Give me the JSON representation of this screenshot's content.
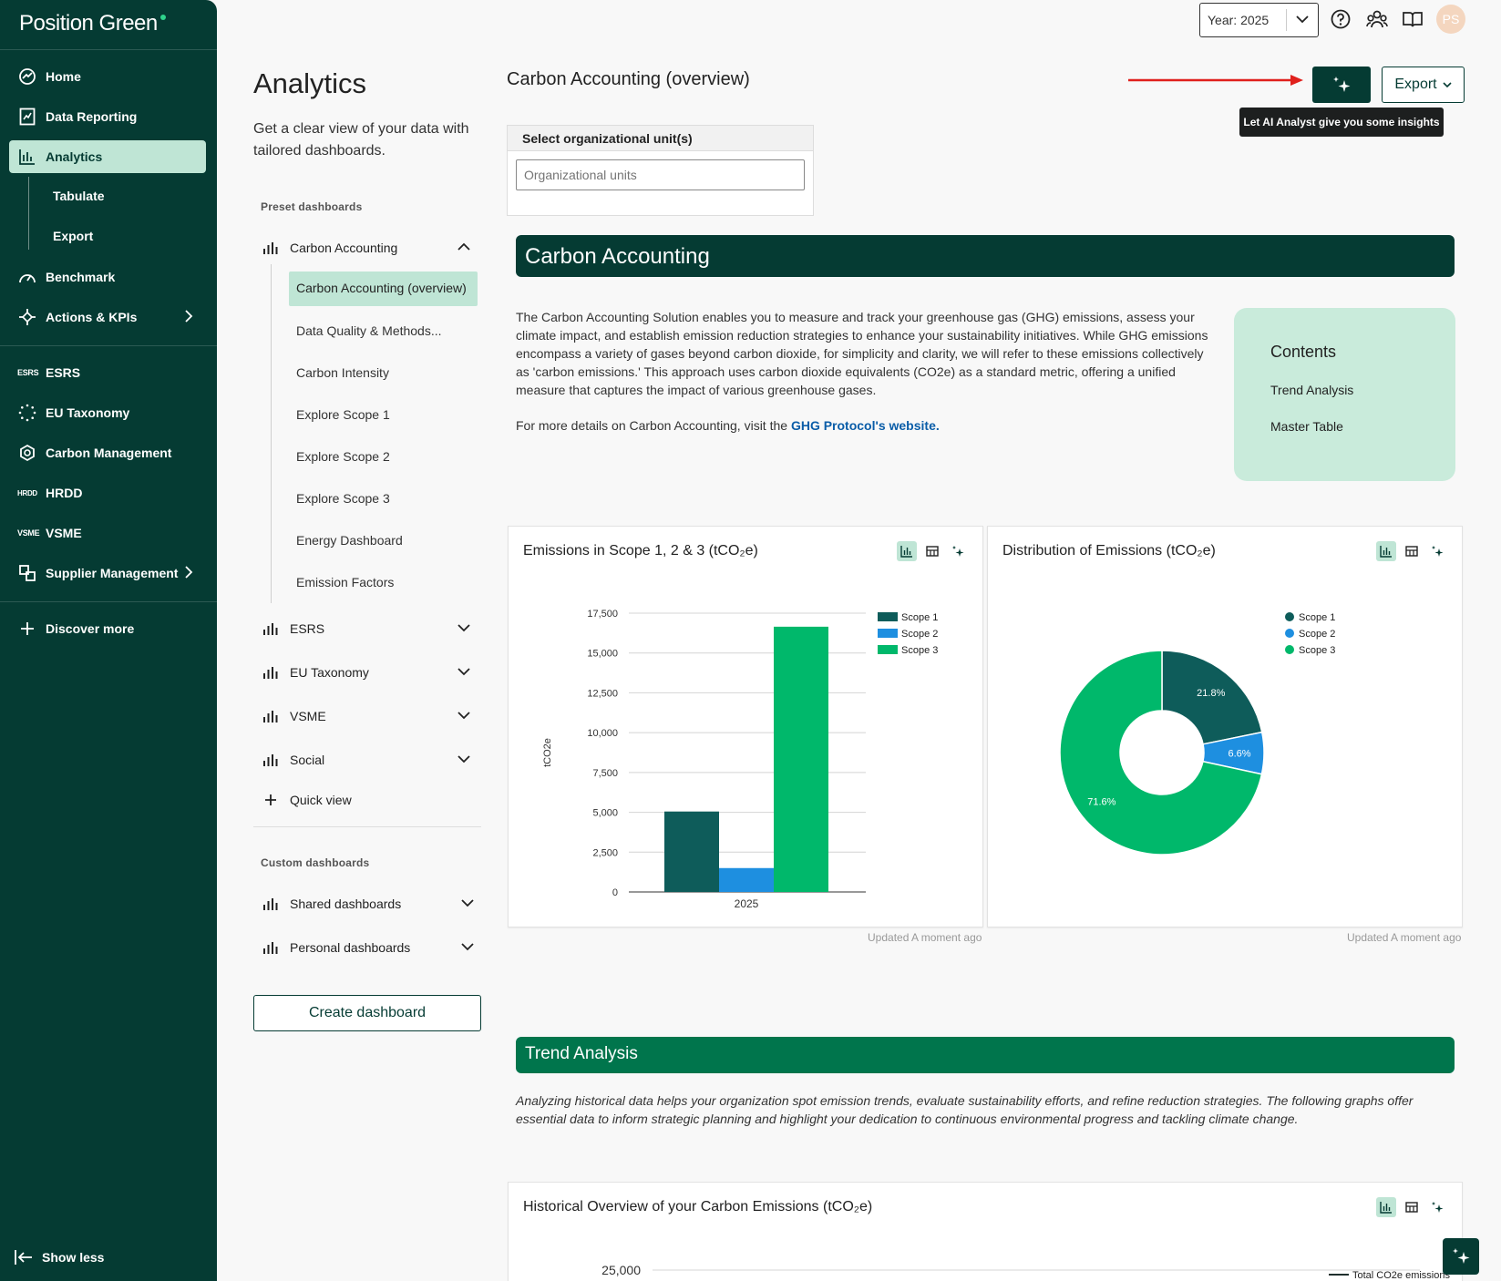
{
  "app": {
    "logo": "Position Green"
  },
  "sidebar": {
    "items": [
      {
        "label": "Home"
      },
      {
        "label": "Data Reporting"
      },
      {
        "label": "Analytics"
      },
      {
        "label": "Benchmark"
      },
      {
        "label": "Actions & KPIs"
      },
      {
        "label": "ESRS",
        "badge": "ESRS"
      },
      {
        "label": "EU Taxonomy"
      },
      {
        "label": "Carbon Management"
      },
      {
        "label": "HRDD",
        "badge": "HRDD"
      },
      {
        "label": "VSME",
        "badge": "VSME"
      },
      {
        "label": "Supplier Management"
      }
    ],
    "sub_items": [
      "Tabulate",
      "Export"
    ],
    "discover": "Discover more",
    "show_less": "Show less"
  },
  "panel": {
    "title": "Analytics",
    "description": "Get a clear view of your data with tailored dashboards.",
    "preset_label": "Preset dashboards",
    "custom_label": "Custom dashboards",
    "groups": [
      "Carbon Accounting",
      "ESRS",
      "EU Taxonomy",
      "VSME",
      "Social"
    ],
    "carbon_items": [
      "Carbon Accounting (overview)",
      "Data Quality & Methods...",
      "Carbon Intensity",
      "Explore Scope 1",
      "Explore Scope 2",
      "Explore Scope 3",
      "Energy Dashboard",
      "Emission Factors"
    ],
    "quick_view": "Quick view",
    "custom_groups": [
      "Shared dashboards",
      "Personal dashboards"
    ],
    "create_button": "Create dashboard"
  },
  "topbar": {
    "year": "Year: 2025",
    "avatar": "PS"
  },
  "header": {
    "title": "Carbon Accounting (overview)",
    "export": "Export",
    "tooltip": "Let AI Analyst give you some insights"
  },
  "org_select": {
    "label": "Select organizational unit(s)",
    "placeholder": "Organizational units"
  },
  "ca_section": {
    "banner": "Carbon Accounting",
    "text": "The Carbon Accounting Solution enables you to measure and track your greenhouse gas (GHG) emissions, assess your climate impact, and establish emission reduction strategies to enhance your sustainability initiatives. While GHG emissions encompass a variety of gases beyond carbon dioxide, for simplicity and clarity, we will refer to these emissions collectively as 'carbon emissions.' This approach uses carbon dioxide equivalents (CO2e) as a standard metric, offering a unified measure that captures the impact of various greenhouse gases.",
    "link_prefix": "For more details on Carbon Accounting, visit the ",
    "link_text": "GHG Protocol's website.",
    "contents_title": "Contents",
    "contents": [
      "Trend Analysis",
      "Master Table"
    ]
  },
  "cards": {
    "bar_title": "Emissions in Scope 1, 2 & 3 (tCO₂e)",
    "pie_title": "Distribution of Emissions (tCO₂e)",
    "hist_title": "Historical Overview of your Carbon Emissions (tCO₂e)",
    "updated": "Updated A moment ago"
  },
  "trend": {
    "banner": "Trend Analysis",
    "text": "Analyzing historical data helps your organization spot emission trends, evaluate sustainability efforts, and refine reduction strategies. The following graphs offer essential data to inform strategic planning and highlight your dedication to continuous environmental progress and tackling climate change."
  },
  "colors": {
    "scope1": "#0e5c5a",
    "scope2": "#1e8fe0",
    "scope3": "#00b86b",
    "brand": "#053b33"
  },
  "chart_data": [
    {
      "type": "bar",
      "title": "Emissions in Scope 1, 2 & 3 (tCO₂e)",
      "ylabel": "tCO2e",
      "categories": [
        "2025"
      ],
      "ylim": [
        0,
        17500
      ],
      "yticks": [
        0,
        2500,
        5000,
        7500,
        10000,
        12500,
        15000,
        17500
      ],
      "legend": "top-right",
      "series": [
        {
          "name": "Scope 1",
          "values": [
            5050
          ]
        },
        {
          "name": "Scope 2",
          "values": [
            1500
          ]
        },
        {
          "name": "Scope 3",
          "values": [
            16650
          ]
        }
      ]
    },
    {
      "type": "pie",
      "title": "Distribution of Emissions (tCO₂e)",
      "legend": "top-right",
      "labels": [
        "Scope 1",
        "Scope 2",
        "Scope 3"
      ],
      "values": [
        21.8,
        6.6,
        71.6
      ],
      "value_labels": [
        "21.8%",
        "6.6%",
        "71.6%"
      ]
    },
    {
      "type": "line",
      "title": "Historical Overview of your Carbon Emissions (tCO₂e)",
      "yticks": [
        25000
      ],
      "series": [
        {
          "name": "Total CO2e emissions",
          "values": []
        }
      ]
    }
  ]
}
